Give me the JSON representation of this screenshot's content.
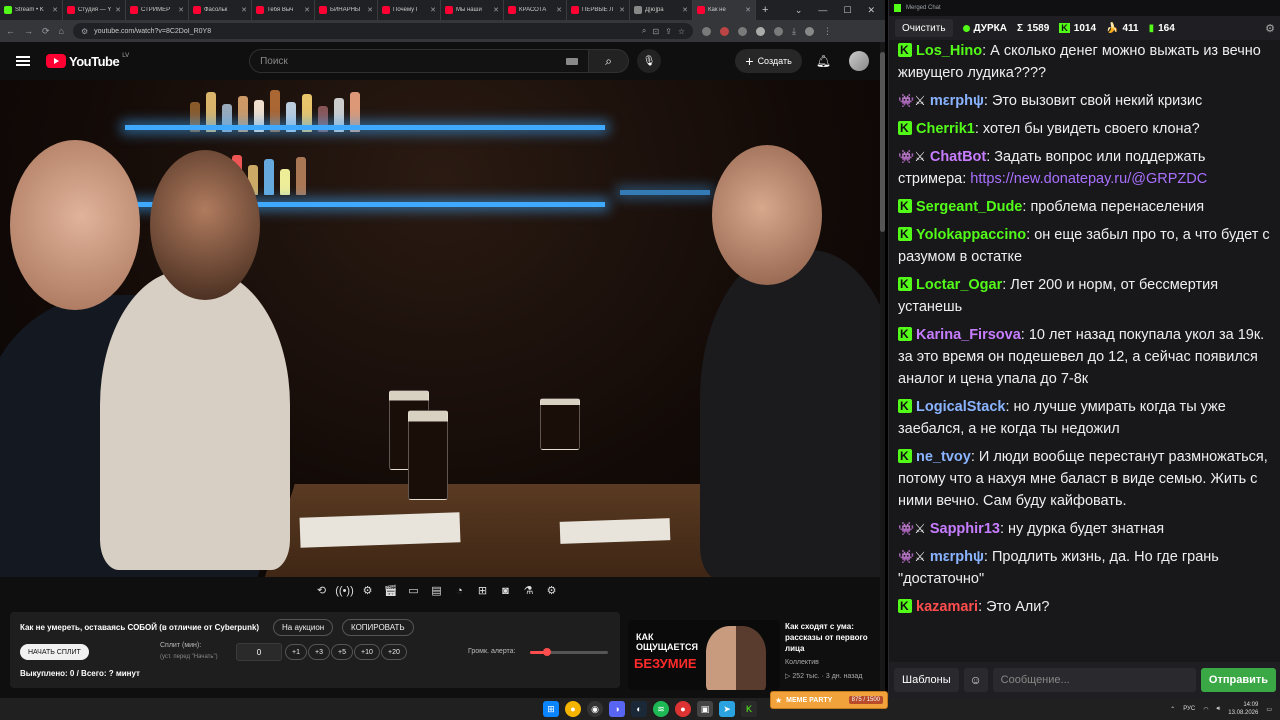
{
  "browser": {
    "tabs": [
      {
        "title": "Stream • K",
        "color": "#53fc18"
      },
      {
        "title": "Студия — Y",
        "color": "#ff0033"
      },
      {
        "title": "СТРИМЕР",
        "color": "#ff0033"
      },
      {
        "title": "Фасольк",
        "color": "#ff0033"
      },
      {
        "title": "Тебя Выч",
        "color": "#ff0033"
      },
      {
        "title": "БИНАРНЫ",
        "color": "#ff0033"
      },
      {
        "title": "Почему Г",
        "color": "#ff0033"
      },
      {
        "title": "Мы наши",
        "color": "#ff0033"
      },
      {
        "title": "КРАСОТА",
        "color": "#ff0033"
      },
      {
        "title": "ПЕРВЫЕ Л",
        "color": "#ff0033"
      },
      {
        "title": "Д[ю]ра",
        "color": "#888888"
      },
      {
        "title": "Как не",
        "color": "#ff0033"
      }
    ],
    "url": "youtube.com/watch?v=8C2DoI_R0Y8"
  },
  "youtube": {
    "logo_text": "YouTube",
    "logo_region": "LV",
    "search_placeholder": "Поиск",
    "create_label": "Создать"
  },
  "panel": {
    "title": "Как не умереть, оставаясь СОБОЙ (в отличие от Cyberpunk)",
    "auction_label": "На аукцион",
    "copy_label": "КОПИРОВАТЬ",
    "start_split_label": "НАЧАТЬ СПЛИТ",
    "split_label": "Сплит (мин):",
    "split_hint": "(уст. перед \"Начать\")",
    "split_value": "0",
    "increments": [
      "+1",
      "+3",
      "+5",
      "+10",
      "+20"
    ],
    "alert_volume_label": "Громк. алерта:",
    "alert_volume": 0.22,
    "stats": "Выкуплено: 0 / Всего: ? минут"
  },
  "recommended": {
    "thumb_line1": "КАК ОЩУЩАЕТСЯ",
    "thumb_line2": "БЕЗУМИЕ",
    "title": "Как сходят с ума: рассказы от первого лица",
    "channel": "Коллектив",
    "meta": "▷ 252 тыс. · 3 дн. назад"
  },
  "chat": {
    "window_title": "Merged Chat",
    "clear_label": "Очистить",
    "channel": "ДУРКА",
    "stats": [
      {
        "icon": "Σ",
        "value": "1589"
      },
      {
        "icon": "K",
        "value": "1014"
      },
      {
        "icon": "🍌",
        "value": "411"
      },
      {
        "icon": "▮",
        "value": "164"
      }
    ],
    "messages": [
      {
        "platform": "kick",
        "user": "Los_Hino",
        "color": "#53fc18",
        "text": "А сколько денег можно выжать из вечно живущего лудика????"
      },
      {
        "platform": "twitch",
        "user": "mεrphψ",
        "color": "#8ab4ff",
        "text": "Это вызовит свой некий кризис"
      },
      {
        "platform": "kick",
        "user": "Cherrik1",
        "color": "#53fc18",
        "text": "хотел бы увидеть своего клона?"
      },
      {
        "platform": "twitch",
        "user": "ChatBot",
        "color": "#c77dff",
        "text": "Задать вопрос или поддержать стримера: ",
        "link": "https://new.donatepay.ru/@GRPZDC"
      },
      {
        "platform": "kick",
        "user": "Sergeant_Dude",
        "color": "#53fc18",
        "text": "проблема перенаселения"
      },
      {
        "platform": "kick",
        "user": "Yolokappaccino",
        "color": "#53fc18",
        "text": "он еще забыл про то, а что будет с разумом в остатке"
      },
      {
        "platform": "kick",
        "user": "Loctar_Ogar",
        "color": "#53fc18",
        "text": "Лет 200 и норм, от бессмертия устанешь"
      },
      {
        "platform": "kick",
        "user": "Karina_Firsova",
        "color": "#c77dff",
        "text": "10 лет назад покупала укол за 19к. за это время он подешевел до 12, а сейчас появился аналог и цена упала до 7-8к"
      },
      {
        "platform": "kick",
        "user": "LogicalStack",
        "color": "#8ab4ff",
        "text": "но лучше умирать когда ты уже заебался, а не когда ты недожил"
      },
      {
        "platform": "kick",
        "user": "ne_tvoy",
        "color": "#8ab4ff",
        "text": "И люди вообще перестанут размножаться, потому что а нахуя мне баласт в виде семью. Жить с ними вечно. Сам буду кайфовать."
      },
      {
        "platform": "twitch",
        "user": "Sapphir13",
        "color": "#c77dff",
        "text": "ну дурка будет знатная"
      },
      {
        "platform": "twitch",
        "user": "mεrphψ",
        "color": "#8ab4ff",
        "text": "Продлить жизнь, да. Но где грань \"достаточно\""
      },
      {
        "platform": "kick",
        "user": "kazamari",
        "color": "#ff4d4d",
        "text": "Это Али?"
      }
    ],
    "templates_label": "Шаблоны",
    "input_placeholder": "Сообщение...",
    "send_label": "Отправить"
  },
  "taskbar": {
    "widget_label": "MEME PARTY",
    "widget_value": "875 / 1500",
    "lang": "РУС",
    "time": "14:09",
    "date": "13.08.2026"
  }
}
